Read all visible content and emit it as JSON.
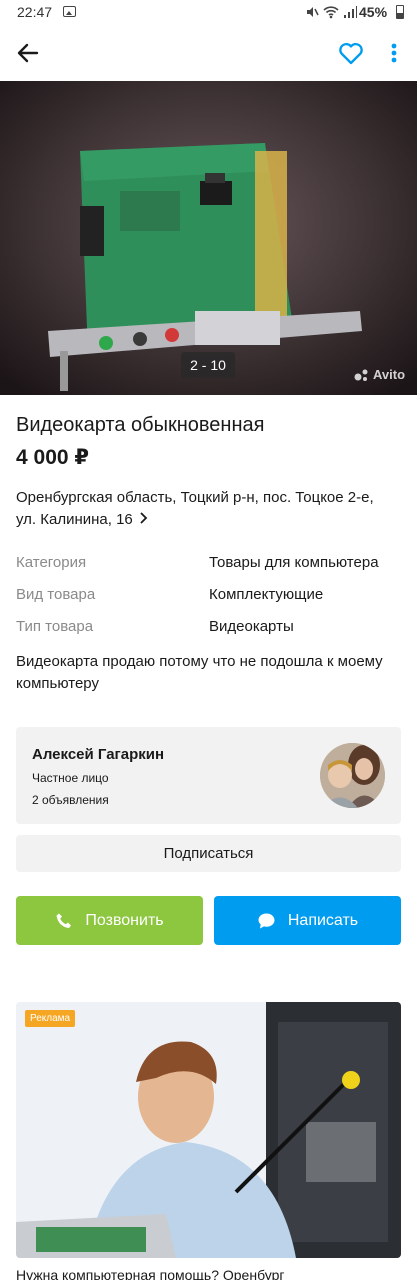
{
  "status_bar": {
    "time": "22:47",
    "battery": "45%"
  },
  "listing": {
    "photo_counter": "2 - 10",
    "watermark": "Avito",
    "title": "Видеокарта обыкновенная",
    "price": "4 000 ₽",
    "address": "Оренбургская область, Тоцкий р-н, пос. Тоцкое 2-е, ул. Калинина, 16",
    "params": [
      {
        "label": "Категория",
        "value": "Товары для компьютера"
      },
      {
        "label": "Вид товара",
        "value": "Комплектующие"
      },
      {
        "label": "Тип товара",
        "value": "Видеокарты"
      }
    ],
    "description": "Видеокарта продаю потому что не подошла к моему компьютеру"
  },
  "seller": {
    "name": "Алексей Гагаркин",
    "type": "Частное лицо",
    "ads_count": "2 объявления"
  },
  "actions": {
    "subscribe": "Подписаться",
    "call": "Позвонить",
    "write": "Написать"
  },
  "ad": {
    "badge": "Реклама",
    "title": "Нужна компьютерная помощь? Оренбург"
  },
  "colors": {
    "call_green": "#8dc63f",
    "write_blue": "#009cf0",
    "heart_blue": "#009cf0",
    "ad_badge_orange": "#f5a623"
  },
  "icons": [
    "back-arrow-icon",
    "heart-icon",
    "more-vertical-icon",
    "phone-icon",
    "chat-bubble-icon",
    "chevron-right-icon"
  ]
}
